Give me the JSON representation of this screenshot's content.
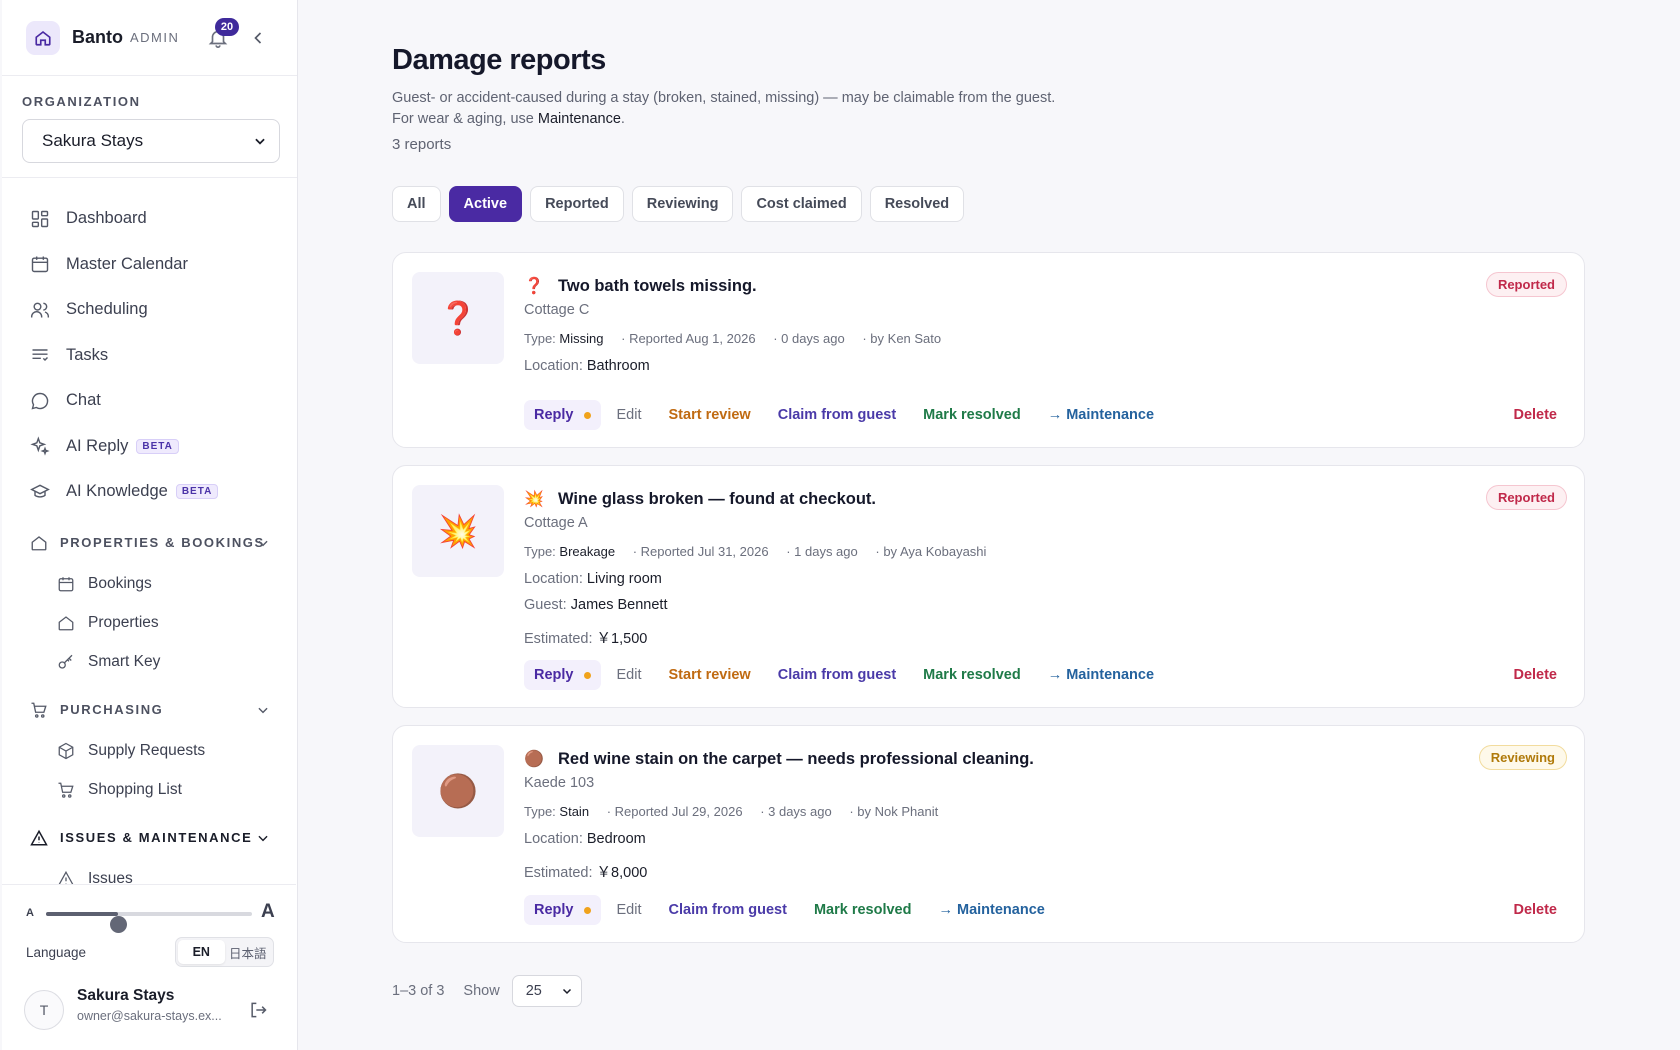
{
  "brand": {
    "name": "Banto",
    "tag": "ADMIN",
    "notifications": "20"
  },
  "org": {
    "label": "ORGANIZATION",
    "selected": "Sakura Stays"
  },
  "nav": {
    "items": [
      {
        "label": "Dashboard"
      },
      {
        "label": "Master Calendar"
      },
      {
        "label": "Scheduling"
      },
      {
        "label": "Tasks"
      },
      {
        "label": "Chat"
      },
      {
        "label": "AI Reply",
        "badge": "BETA"
      },
      {
        "label": "AI Knowledge",
        "badge": "BETA"
      }
    ],
    "sections": [
      {
        "label": "PROPERTIES & BOOKINGS",
        "items": [
          {
            "label": "Bookings"
          },
          {
            "label": "Properties"
          },
          {
            "label": "Smart Key"
          }
        ]
      },
      {
        "label": "PURCHASING",
        "items": [
          {
            "label": "Supply Requests"
          },
          {
            "label": "Shopping List"
          }
        ]
      },
      {
        "label": "ISSUES & MAINTENANCE",
        "items": [
          {
            "label": "Issues"
          }
        ]
      }
    ]
  },
  "footer": {
    "font_small": "A",
    "font_large": "A",
    "font_scale_fraction": 0.35,
    "language_label": "Language",
    "lang_en": "EN",
    "lang_ja": "日本語",
    "user_initial": "T",
    "user_name": "Sakura Stays",
    "user_email": "owner@sakura-stays.ex..."
  },
  "page": {
    "title": "Damage reports",
    "desc_before": "Guest- or accident-caused during a stay (broken, stained, missing) — may be claimable from the guest. For wear & aging, use ",
    "desc_link": "Maintenance",
    "desc_after": ".",
    "count": "3 reports"
  },
  "tabs": [
    "All",
    "Active",
    "Reported",
    "Reviewing",
    "Cost claimed",
    "Resolved"
  ],
  "labels": {
    "type": "Type:",
    "location": "Location:",
    "guest": "Guest:",
    "estimated": "Estimated:",
    "reply": "Reply",
    "edit": "Edit",
    "start_review": "Start review",
    "claim": "Claim from guest",
    "resolve": "Mark resolved",
    "maintenance": "→ Maintenance",
    "delete": "Delete"
  },
  "reports": [
    {
      "icon": "❓",
      "title": "Two bath towels missing.",
      "place": "Cottage C",
      "type": "Missing",
      "reported": "· Reported Aug 1, 2026",
      "ago": "· 0 days ago",
      "by": "· by Ken Sato",
      "location": "Bathroom",
      "status": "Reported"
    },
    {
      "icon": "💥",
      "title": "Wine glass broken — found at checkout.",
      "place": "Cottage A",
      "type": "Breakage",
      "reported": "· Reported Jul 31, 2026",
      "ago": "· 1 days ago",
      "by": "· by Aya Kobayashi",
      "location": "Living room",
      "guest": "James Bennett",
      "estimated": "￥1,500",
      "status": "Reported"
    },
    {
      "icon": "🟤",
      "title": "Red wine stain on the carpet — needs professional cleaning.",
      "place": "Kaede 103",
      "type": "Stain",
      "reported": "· Reported Jul 29, 2026",
      "ago": "· 3 days ago",
      "by": "· by Nok Phanit",
      "location": "Bedroom",
      "estimated": "￥8,000",
      "status": "Reviewing"
    }
  ],
  "pager": {
    "range": "1–3 of 3",
    "show_label": "Show",
    "page_size": "25"
  },
  "colors": {
    "accent": "#4a2aa3",
    "reported": "#c0294a",
    "reviewing": "#b07a0a"
  }
}
